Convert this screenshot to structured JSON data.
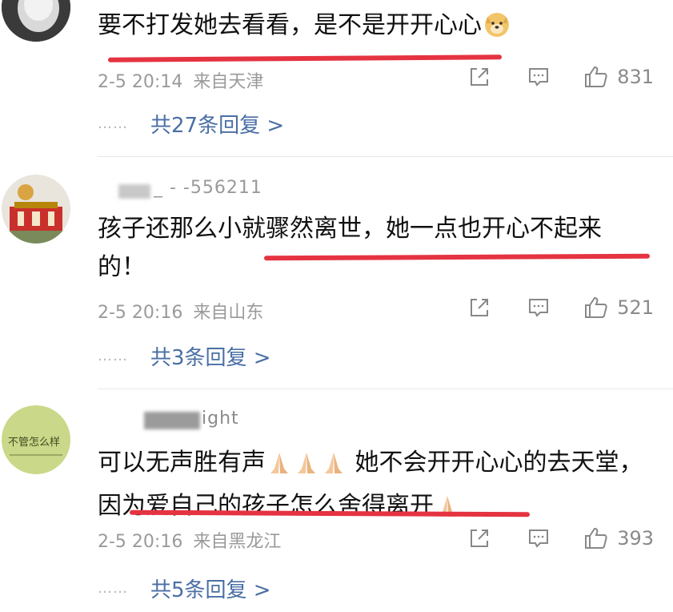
{
  "comments": [
    {
      "text": "要不打发她去看看，是不是开开心心",
      "emoji_trailing": "doge-emoji",
      "time": "2-5 20:14",
      "location": "来自天津",
      "likes": "831",
      "replies_label": "共27条回复 >"
    },
    {
      "username": "_ - -556211",
      "text": "孩子还那么小就骤然离世，她一点也开心不起来的！",
      "time": "2-5 20:16",
      "location": "来自山东",
      "likes": "521",
      "replies_label": "共3条回复 >"
    },
    {
      "username": "ight",
      "text_part1": "可以无声胜有声",
      "text_part2": "她不会开开心心的去天堂，因为爱自己的孩子怎么舍得离开",
      "emoji": "praying-hands-emoji",
      "time": "2-5 20:16",
      "location": "来自黑龙江",
      "likes": "393",
      "replies_label": "共5条回复 >"
    }
  ],
  "avatar_texts": {
    "c3": "不管怎么样"
  },
  "dots": "……",
  "colors": {
    "underline": "#e53341",
    "link": "#4a6fa5",
    "meta": "#9a9a9a"
  }
}
